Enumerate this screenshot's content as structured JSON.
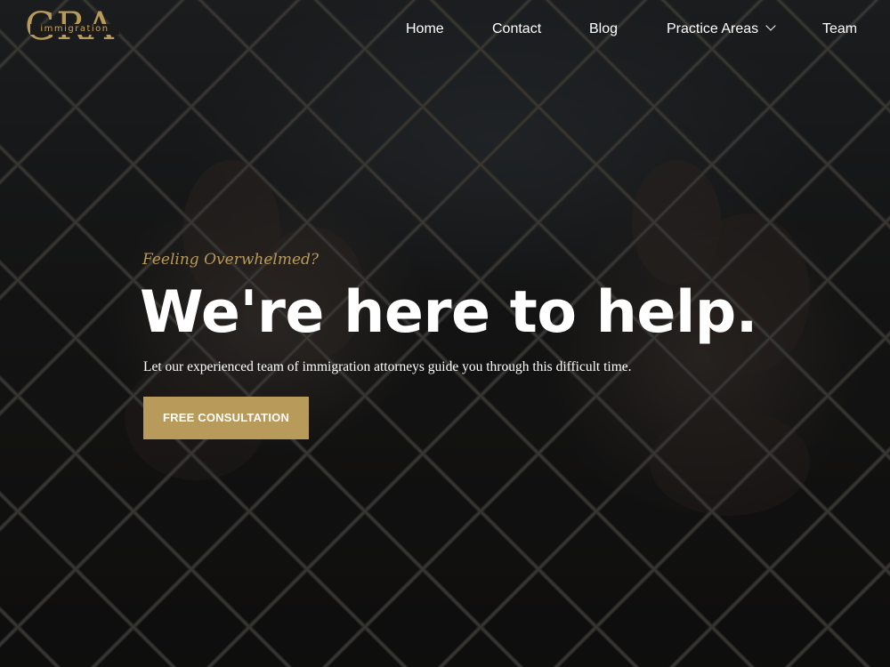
{
  "header": {
    "logo": {
      "letters": "GRA",
      "sub": "immigration"
    },
    "nav": [
      {
        "label": "Home"
      },
      {
        "label": "Contact"
      },
      {
        "label": "Blog"
      },
      {
        "label": "Practice Areas",
        "icon": "chevron-down-icon"
      },
      {
        "label": "Team"
      }
    ]
  },
  "hero": {
    "eyebrow": "Feeling Overwhelmed?",
    "headline": "We're here to help.",
    "subtext": "Let our experienced team of immigration attorneys guide you through this difficult time.",
    "cta_label": "FREE CONSULTATION",
    "background": "chain-link fence with hands gripping it"
  },
  "colors": {
    "accent": "#b89a5a",
    "text": "#ffffff",
    "background": "#141312"
  }
}
